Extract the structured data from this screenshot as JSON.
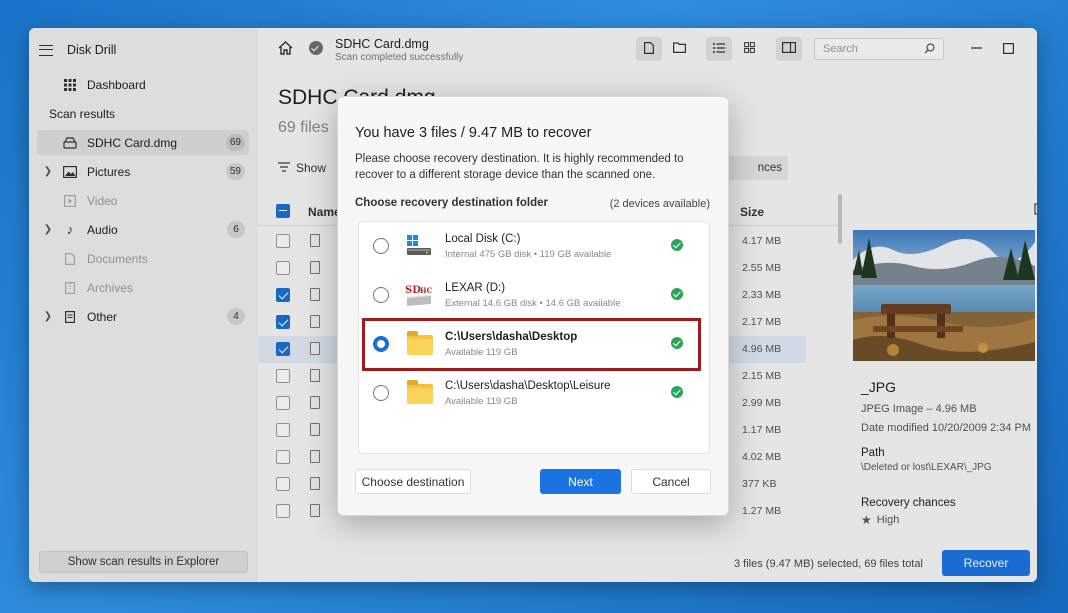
{
  "sidebar": {
    "app_title": "Disk Drill",
    "dashboard_label": "Dashboard",
    "section_label": "Scan results",
    "items": [
      {
        "label": "SDHC Card.dmg",
        "count": "69"
      },
      {
        "label": "Pictures",
        "count": "59"
      },
      {
        "label": "Video",
        "count": ""
      },
      {
        "label": "Audio",
        "count": "6"
      },
      {
        "label": "Documents",
        "count": ""
      },
      {
        "label": "Archives",
        "count": ""
      },
      {
        "label": "Other",
        "count": "4"
      }
    ],
    "explorer_button": "Show scan results in Explorer"
  },
  "topbar": {
    "title": "SDHC Card.dmg",
    "subtitle": "Scan completed successfully",
    "search_placeholder": "Search"
  },
  "main": {
    "page_title": "SDHC Card.dmg",
    "page_subtitle": "69 files",
    "show_label": "Show",
    "chances_label": "nces",
    "columns": {
      "name": "Name",
      "size": "Size"
    },
    "rows": [
      {
        "size": "4.17 MB",
        "checked": false,
        "selected": false
      },
      {
        "size": "2.55 MB",
        "checked": false,
        "selected": false
      },
      {
        "size": "2.33 MB",
        "checked": true,
        "selected": false
      },
      {
        "size": "2.17 MB",
        "checked": true,
        "selected": false
      },
      {
        "size": "4.96 MB",
        "checked": true,
        "selected": true
      },
      {
        "size": "2.15 MB",
        "checked": false,
        "selected": false
      },
      {
        "size": "2.99 MB",
        "checked": false,
        "selected": false
      },
      {
        "size": "1.17 MB",
        "checked": false,
        "selected": false
      },
      {
        "size": "4.02 MB",
        "checked": false,
        "selected": false
      },
      {
        "size": "377 KB",
        "checked": false,
        "selected": false
      },
      {
        "size": "1.27 MB",
        "checked": false,
        "selected": false
      }
    ]
  },
  "preview": {
    "file_name": "_JPG",
    "file_type": "JPEG Image – 4.96 MB",
    "date_modified": "Date modified 10/20/2009 2:34 PM",
    "path_label": "Path",
    "path_value": "\\Deleted or lost\\LEXAR\\_JPG",
    "chances_label": "Recovery chances",
    "chances_value": "High"
  },
  "footer": {
    "selection_text": "3 files (9.47 MB) selected, 69 files total",
    "recover_button": "Recover"
  },
  "modal": {
    "title": "You have 3 files / 9.47 MB to recover",
    "description": "Please choose recovery destination. It is highly recommended to recover to a different storage device than the scanned one.",
    "choose_label": "Choose recovery destination folder",
    "devices_count": "(2 devices available)",
    "destinations": [
      {
        "name": "Local Disk (C:)",
        "detail": "Internal 475 GB disk • 119 GB available",
        "icon": "windows-drive-icon"
      },
      {
        "name": "LEXAR (D:)",
        "detail": "External 14.6 GB disk • 14.6 GB available",
        "icon": "sdhc-card-icon"
      },
      {
        "name": "C:\\Users\\dasha\\Desktop",
        "detail": "Available 119 GB",
        "icon": "folder-icon"
      },
      {
        "name": "C:\\Users\\dasha\\Desktop\\Leisure",
        "detail": "Available 119 GB",
        "icon": "folder-icon"
      }
    ],
    "selected_index": 2,
    "choose_destination_button": "Choose destination",
    "next_button": "Next",
    "cancel_button": "Cancel"
  },
  "colors": {
    "accent": "#1a73e0",
    "highlight_border": "#a01c1c",
    "success": "#2aa55a"
  }
}
